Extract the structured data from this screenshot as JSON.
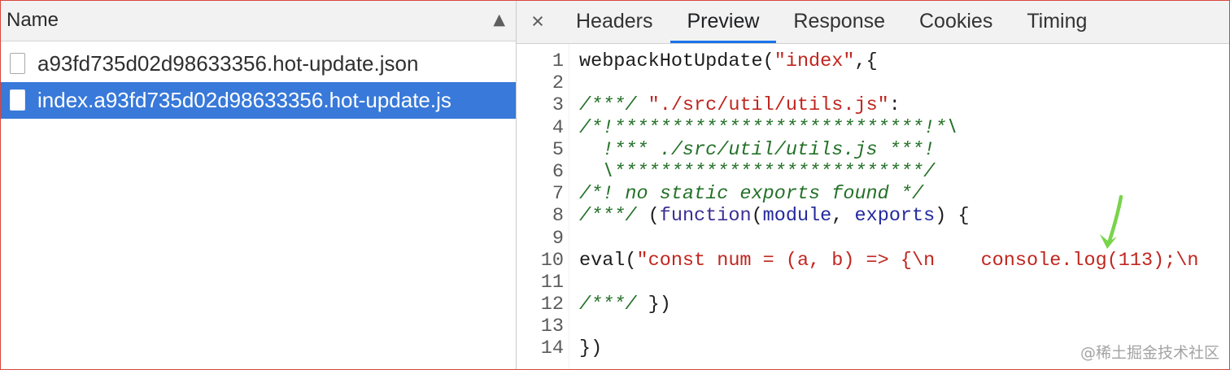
{
  "requests": {
    "header": {
      "name_label": "Name",
      "sort_glyph": "▲",
      "sort_icon": "sort-ascending-icon"
    },
    "items": [
      {
        "name": "a93fd735d02d98633356.hot-update.json",
        "icon": "document-icon",
        "selected": false
      },
      {
        "name": "index.a93fd735d02d98633356.hot-update.js",
        "icon": "document-icon",
        "selected": true
      }
    ]
  },
  "preview": {
    "close_glyph": "×",
    "close_icon": "close-icon",
    "tabs": [
      {
        "label": "Headers",
        "active": false
      },
      {
        "label": "Preview",
        "active": true
      },
      {
        "label": "Response",
        "active": false
      },
      {
        "label": "Cookies",
        "active": false
      },
      {
        "label": "Timing",
        "active": false
      }
    ],
    "code": {
      "lines": [
        {
          "number": 1,
          "tokens": [
            {
              "type": "plain",
              "text": "webpackHotUpdate("
            },
            {
              "type": "string",
              "text": "\"index\""
            },
            {
              "type": "plain",
              "text": ",{"
            }
          ]
        },
        {
          "number": 2,
          "tokens": []
        },
        {
          "number": 3,
          "tokens": [
            {
              "type": "comment",
              "text": "/***/"
            },
            {
              "type": "plain",
              "text": " "
            },
            {
              "type": "string",
              "text": "\"./src/util/utils.js\""
            },
            {
              "type": "plain",
              "text": ":"
            }
          ]
        },
        {
          "number": 4,
          "tokens": [
            {
              "type": "comment",
              "text": "/*!***************************!*\\"
            }
          ]
        },
        {
          "number": 5,
          "tokens": [
            {
              "type": "comment",
              "text": "  !*** ./src/util/utils.js ***!"
            }
          ]
        },
        {
          "number": 6,
          "tokens": [
            {
              "type": "comment",
              "text": "  \\***************************/"
            }
          ]
        },
        {
          "number": 7,
          "tokens": [
            {
              "type": "comment",
              "text": "/*! no static exports found */"
            }
          ]
        },
        {
          "number": 8,
          "tokens": [
            {
              "type": "comment",
              "text": "/***/"
            },
            {
              "type": "plain",
              "text": " ("
            },
            {
              "type": "keyword",
              "text": "function"
            },
            {
              "type": "plain",
              "text": "("
            },
            {
              "type": "def",
              "text": "module"
            },
            {
              "type": "plain",
              "text": ", "
            },
            {
              "type": "def",
              "text": "exports"
            },
            {
              "type": "plain",
              "text": ") {"
            }
          ]
        },
        {
          "number": 9,
          "tokens": []
        },
        {
          "number": 10,
          "tokens": [
            {
              "type": "plain",
              "text": "eval("
            },
            {
              "type": "string",
              "text": "\"const num = (a, b) => {\\n    console.log(113);\\n"
            }
          ]
        },
        {
          "number": 11,
          "tokens": []
        },
        {
          "number": 12,
          "tokens": [
            {
              "type": "comment",
              "text": "/***/"
            },
            {
              "type": "plain",
              "text": " })"
            }
          ]
        },
        {
          "number": 13,
          "tokens": []
        },
        {
          "number": 14,
          "tokens": [
            {
              "type": "plain",
              "text": "})"
            }
          ]
        }
      ]
    }
  },
  "annotation": {
    "icon": "arrow-down-icon"
  },
  "watermark": "@稀土掘金技术社区",
  "colors": {
    "frame_border": "#d9463e",
    "selection": "#3879d9",
    "active_tab": "#1a73e8",
    "string": "#c0261f",
    "comment": "#247128",
    "keyword": "#3b2f93",
    "definition": "#23299c",
    "annotation_arrow": "#79d44c"
  }
}
